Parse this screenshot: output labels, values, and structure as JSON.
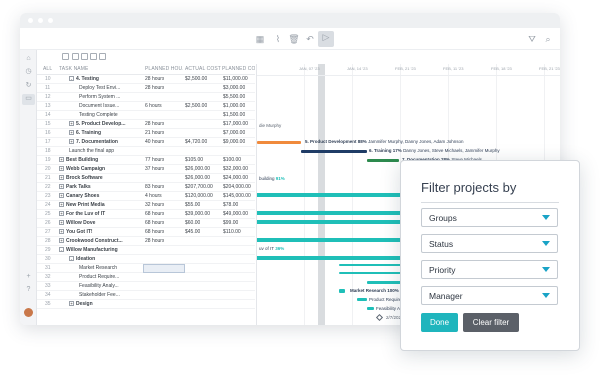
{
  "toolbar": {
    "icons": [
      "grid-icon",
      "route-icon",
      "trash-icon",
      "undo-icon",
      "run-icon",
      "filter-icon",
      "search-icon"
    ]
  },
  "sidebar": {
    "icons": [
      "home-icon",
      "clock-icon",
      "refresh-icon",
      "briefcase-icon",
      "plus-icon",
      "help-icon"
    ]
  },
  "grid": {
    "headers": {
      "all": "ALL",
      "task_name": "TASK NAME",
      "planned_hours": "PLANNED HOU...",
      "actual_cost": "ACTUAL COST",
      "planned_cost": "PLANNED CO"
    },
    "rows": [
      {
        "n": "10",
        "name": "4. Testing",
        "hours": "28 hours",
        "actual": "$2,500.00",
        "planned": "$11,000.00",
        "bold": true,
        "indent": 1,
        "toggle": "-"
      },
      {
        "n": "11",
        "name": "Deploy Test Envi...",
        "hours": "28 hours",
        "actual": "",
        "planned": "$3,000.00",
        "bold": false,
        "indent": 2,
        "toggle": ""
      },
      {
        "n": "12",
        "name": "Perform System ...",
        "hours": "",
        "actual": "",
        "planned": "$5,500.00",
        "bold": false,
        "indent": 2,
        "toggle": ""
      },
      {
        "n": "13",
        "name": "Document Issue...",
        "hours": "6 hours",
        "actual": "$2,500.00",
        "planned": "$1,000.00",
        "bold": false,
        "indent": 2,
        "toggle": ""
      },
      {
        "n": "14",
        "name": "Testing Complete",
        "hours": "",
        "actual": "",
        "planned": "$1,500.00",
        "bold": false,
        "indent": 2,
        "toggle": ""
      },
      {
        "n": "15",
        "name": "5. Product Develop...",
        "hours": "28 hours",
        "actual": "",
        "planned": "$17,000.00",
        "bold": true,
        "indent": 1,
        "toggle": "+"
      },
      {
        "n": "16",
        "name": "6. Training",
        "hours": "21 hours",
        "actual": "",
        "planned": "$7,000.00",
        "bold": true,
        "indent": 1,
        "toggle": "+"
      },
      {
        "n": "17",
        "name": "7. Documentation",
        "hours": "40 hours",
        "actual": "$4,720.00",
        "planned": "$9,000.00",
        "bold": true,
        "indent": 1,
        "toggle": "+"
      },
      {
        "n": "18",
        "name": "Launch the final app",
        "hours": "",
        "actual": "",
        "planned": "",
        "bold": false,
        "indent": 1,
        "toggle": ""
      },
      {
        "n": "19",
        "name": "Best Building",
        "hours": "77 hours",
        "actual": "$105.00",
        "planned": "$100.00",
        "bold": true,
        "indent": 0,
        "toggle": "+"
      },
      {
        "n": "20",
        "name": "Webb Campaign",
        "hours": "37 hours",
        "actual": "$26,000.00",
        "planned": "$32,000.00",
        "bold": true,
        "indent": 0,
        "toggle": "+"
      },
      {
        "n": "21",
        "name": "Brock Software",
        "hours": "",
        "actual": "$26,000.00",
        "planned": "$24,000.00",
        "bold": true,
        "indent": 0,
        "toggle": "+"
      },
      {
        "n": "22",
        "name": "Park Talks",
        "hours": "83 hours",
        "actual": "$207,700.00",
        "planned": "$204,000.00",
        "bold": true,
        "indent": 0,
        "toggle": "+"
      },
      {
        "n": "23",
        "name": "Canary Shoes",
        "hours": "4 hours",
        "actual": "$120,000.00",
        "planned": "$145,000.00",
        "bold": true,
        "indent": 0,
        "toggle": "+"
      },
      {
        "n": "24",
        "name": "New Print Media",
        "hours": "32 hours",
        "actual": "$55.00",
        "planned": "$78.00",
        "bold": true,
        "indent": 0,
        "toggle": "+"
      },
      {
        "n": "25",
        "name": "For the Luv of IT",
        "hours": "68 hours",
        "actual": "$39,000.00",
        "planned": "$49,000.00",
        "bold": true,
        "indent": 0,
        "toggle": "+"
      },
      {
        "n": "26",
        "name": "Willow Dove",
        "hours": "68 hours",
        "actual": "$60.00",
        "planned": "$99.00",
        "bold": true,
        "indent": 0,
        "toggle": "+"
      },
      {
        "n": "27",
        "name": "You Got IT!",
        "hours": "68 hours",
        "actual": "$45.00",
        "planned": "$110.00",
        "bold": true,
        "indent": 0,
        "toggle": "+"
      },
      {
        "n": "28",
        "name": "Crookwood Construct...",
        "hours": "28 hours",
        "actual": "",
        "planned": "",
        "bold": true,
        "indent": 0,
        "toggle": "+"
      },
      {
        "n": "29",
        "name": "Willow Manufacturing",
        "hours": "",
        "actual": "",
        "planned": "",
        "bold": true,
        "indent": 0,
        "toggle": "-"
      },
      {
        "n": "30",
        "name": "Ideation",
        "hours": "",
        "actual": "",
        "planned": "",
        "bold": true,
        "indent": 1,
        "toggle": "-"
      },
      {
        "n": "31",
        "name": "Market Research",
        "hours": "",
        "actual": "",
        "planned": "",
        "bold": false,
        "indent": 2,
        "toggle": ""
      },
      {
        "n": "32",
        "name": "Product Require...",
        "hours": "",
        "actual": "",
        "planned": "",
        "bold": false,
        "indent": 2,
        "toggle": ""
      },
      {
        "n": "33",
        "name": "Feasibility Analy...",
        "hours": "",
        "actual": "",
        "planned": "",
        "bold": false,
        "indent": 2,
        "toggle": ""
      },
      {
        "n": "34",
        "name": "Stakeholder Fee...",
        "hours": "",
        "actual": "",
        "planned": "",
        "bold": false,
        "indent": 2,
        "toggle": ""
      },
      {
        "n": "35",
        "name": "Design",
        "hours": "",
        "actual": "",
        "planned": "",
        "bold": true,
        "indent": 1,
        "toggle": "+"
      }
    ]
  },
  "gantt": {
    "dates": [
      "JAN, 07 '23",
      "JAN, 14 '23",
      "FEB, 21 '23",
      "FEB, 11 '23",
      "FEB, 18 '23",
      "FEB, 21 '23"
    ],
    "labels": {
      "murphy": "die Murphy",
      "product_dev": "5. Product Development",
      "product_dev_pct": "88%",
      "product_dev_people": "Jammifer Murphy, Danny Jones, Adam Johnson",
      "training": "6. Training",
      "training_pct": "17%",
      "training_people": "Danny Jones, Steve Michaels, Jammifer Murphy",
      "documentation": "7. Documentation",
      "documentation_pct": "28%",
      "documentation_people": "Steve Michaels",
      "launch": "Launch the final app",
      "launch_pct": "0%",
      "building": "building",
      "building_pct": "91%",
      "luv": "uv of IT",
      "luv_pct": "36%",
      "ideation": "Ideation",
      "ideation_pct": "90%",
      "ideation_people": "Jennifer Murphy",
      "market": "Market Research",
      "market_pct": "100%",
      "market_people": "Jennifer M",
      "product_req": "Product Requirem",
      "feasibility": "Feasibility Analys",
      "milestone_date": "2/7/2023"
    }
  },
  "filter_panel": {
    "title": "Filter projects by",
    "dropdowns": [
      "Groups",
      "Status",
      "Priority",
      "Manager"
    ],
    "done_label": "Done",
    "clear_label": "Clear filter"
  },
  "colors": {
    "accent": "#1fb5bd",
    "orange": "#f08a3c",
    "navy": "#1f3c66",
    "green": "#2d8a4e",
    "teal": "#1fbfb8"
  }
}
